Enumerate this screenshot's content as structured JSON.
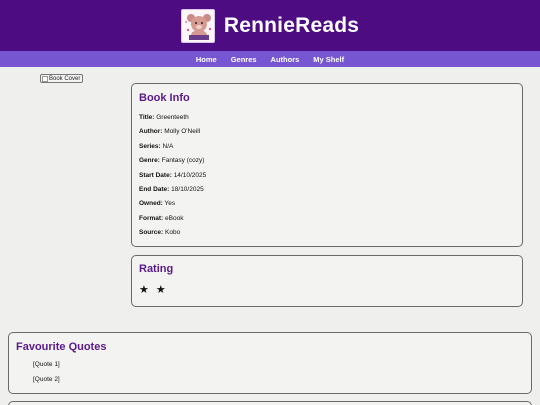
{
  "site": {
    "title": "RennieReads",
    "logo_icon": "teddy-bear-icon",
    "colors": {
      "header": "#4e0c83",
      "nav": "#7757d1",
      "heading": "#5a1a8c"
    }
  },
  "nav": {
    "items": [
      {
        "label": "Home"
      },
      {
        "label": "Genres"
      },
      {
        "label": "Authors"
      },
      {
        "label": "My Shelf"
      }
    ]
  },
  "cover": {
    "alt": "Book Cover"
  },
  "book_info": {
    "heading": "Book Info",
    "rows": [
      {
        "label": "Title:",
        "value": "Greenteeth"
      },
      {
        "label": "Author:",
        "value": "Molly O'Neill"
      },
      {
        "label": "Series:",
        "value": "N/A"
      },
      {
        "label": "Genre:",
        "value": "Fantasy (cozy)"
      },
      {
        "label": "Start Date:",
        "value": "14/10/2025"
      },
      {
        "label": "End Date:",
        "value": "18/10/2025"
      },
      {
        "label": "Owned:",
        "value": "Yes"
      },
      {
        "label": "Format:",
        "value": "eBook"
      },
      {
        "label": "Source:",
        "value": "Kobo"
      }
    ]
  },
  "rating": {
    "heading": "Rating",
    "stars_text": "★ ★",
    "value": 2
  },
  "quotes": {
    "heading": "Favourite Quotes",
    "items": [
      "[Quote 1]",
      "[Quote 2]"
    ]
  }
}
